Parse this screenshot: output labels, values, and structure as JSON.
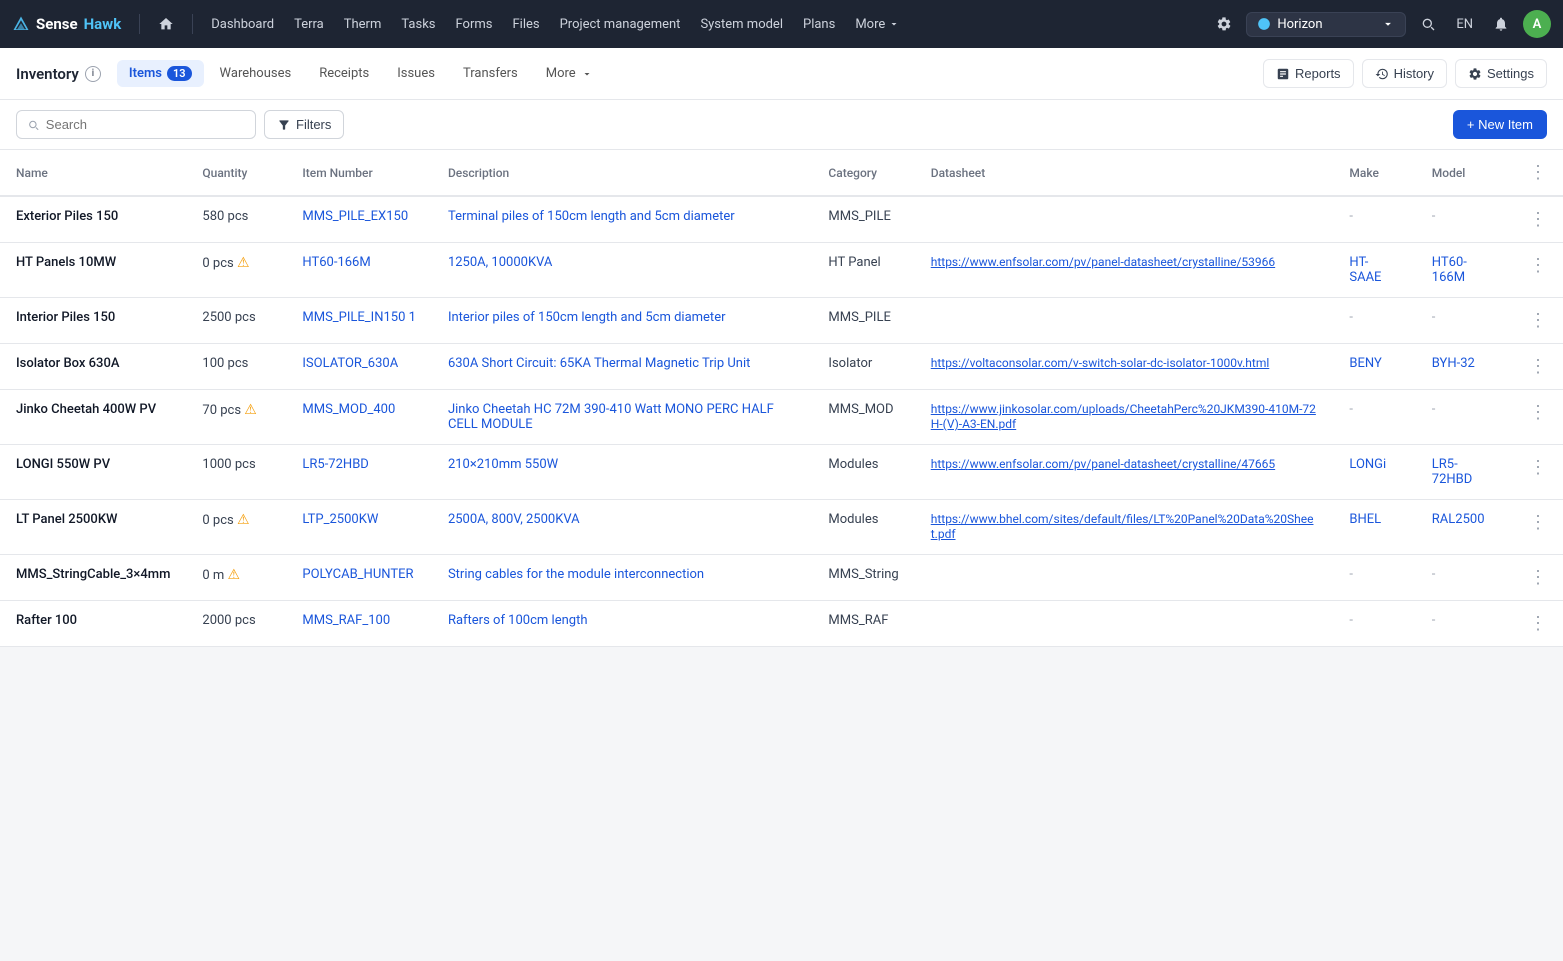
{
  "topNav": {
    "logo": {
      "sense": "Sense",
      "hawk": "Hawk"
    },
    "links": [
      "Dashboard",
      "Terra",
      "Therm",
      "Tasks",
      "Forms",
      "Files",
      "Project management",
      "System model",
      "Plans"
    ],
    "more": "More",
    "project": "Horizon",
    "lang": "EN",
    "avatarInitial": "A"
  },
  "subNav": {
    "title": "Inventory",
    "tabs": [
      {
        "label": "Items",
        "badge": "13",
        "active": true
      },
      {
        "label": "Warehouses",
        "badge": null,
        "active": false
      },
      {
        "label": "Receipts",
        "badge": null,
        "active": false
      },
      {
        "label": "Issues",
        "badge": null,
        "active": false
      },
      {
        "label": "Transfers",
        "badge": null,
        "active": false
      },
      {
        "label": "More",
        "badge": null,
        "active": false,
        "arrow": true
      }
    ],
    "actions": {
      "reports": "Reports",
      "history": "History",
      "settings": "Settings"
    }
  },
  "toolbar": {
    "searchPlaceholder": "Search",
    "filtersLabel": "Filters",
    "newItemLabel": "+ New Item"
  },
  "table": {
    "columns": [
      "Name",
      "Quantity",
      "Item Number",
      "Description",
      "Category",
      "Datasheet",
      "Make",
      "Model"
    ],
    "rows": [
      {
        "name": "Exterior Piles 150",
        "quantity": "580 pcs",
        "qtyWarn": false,
        "itemNumber": "MMS_PILE_EX150",
        "description": "Terminal piles of 150cm length and 5cm diameter",
        "category": "MMS_PILE",
        "datasheet": "",
        "make": "-",
        "model": "-"
      },
      {
        "name": "HT Panels 10MW",
        "quantity": "0 pcs",
        "qtyWarn": true,
        "itemNumber": "HT60-166M",
        "description": "1250A, 10000KVA",
        "category": "HT Panel",
        "datasheet": "https://www.enfsolar.com/pv/panel-datasheet/crystalline/53966",
        "make": "HT-SAAE",
        "model": "HT60-166M"
      },
      {
        "name": "Interior Piles 150",
        "quantity": "2500 pcs",
        "qtyWarn": false,
        "itemNumber": "MMS_PILE_IN150 1",
        "description": "Interior piles of 150cm length and 5cm diameter",
        "category": "MMS_PILE",
        "datasheet": "",
        "make": "-",
        "model": "-"
      },
      {
        "name": "Isolator Box 630A",
        "quantity": "100 pcs",
        "qtyWarn": false,
        "itemNumber": "ISOLATOR_630A",
        "description": "630A Short Circuit: 65KA Thermal Magnetic Trip Unit",
        "category": "Isolator",
        "datasheet": "https://voltaconsolar.com/v-switch-solar-dc-isolator-1000v.html",
        "make": "BENY",
        "model": "BYH-32"
      },
      {
        "name": "Jinko Cheetah 400W PV",
        "quantity": "70 pcs",
        "qtyWarn": true,
        "itemNumber": "MMS_MOD_400",
        "description": "Jinko Cheetah HC 72M 390-410 Watt MONO PERC HALF CELL MODULE",
        "category": "MMS_MOD",
        "datasheet": "https://www.jinkosolar.com/uploads/CheetahPerc%20JKM390-410M-72H-(V)-A3-EN.pdf",
        "make": "-",
        "model": "-"
      },
      {
        "name": "LONGI 550W PV",
        "quantity": "1000 pcs",
        "qtyWarn": false,
        "itemNumber": "LR5-72HBD",
        "description": "210×210mm 550W",
        "category": "Modules",
        "datasheet": "https://www.enfsolar.com/pv/panel-datasheet/crystalline/47665",
        "make": "LONGi",
        "model": "LR5-72HBD"
      },
      {
        "name": "LT Panel 2500KW",
        "quantity": "0 pcs",
        "qtyWarn": true,
        "itemNumber": "LTP_2500KW",
        "description": "2500A, 800V, 2500KVA",
        "category": "Modules",
        "datasheet": "https://www.bhel.com/sites/default/files/LT%20Panel%20Data%20Sheet.pdf",
        "make": "BHEL",
        "model": "RAL2500"
      },
      {
        "name": "MMS_StringCable_3×4mm",
        "quantity": "0 m",
        "qtyWarn": true,
        "itemNumber": "POLYCAB_HUNTER",
        "description": "String cables for the module interconnection",
        "category": "MMS_String",
        "datasheet": "",
        "make": "-",
        "model": "-"
      },
      {
        "name": "Rafter 100",
        "quantity": "2000 pcs",
        "qtyWarn": false,
        "itemNumber": "MMS_RAF_100",
        "description": "Rafters of 100cm length",
        "category": "MMS_RAF",
        "datasheet": "",
        "make": "-",
        "model": "-"
      }
    ]
  }
}
